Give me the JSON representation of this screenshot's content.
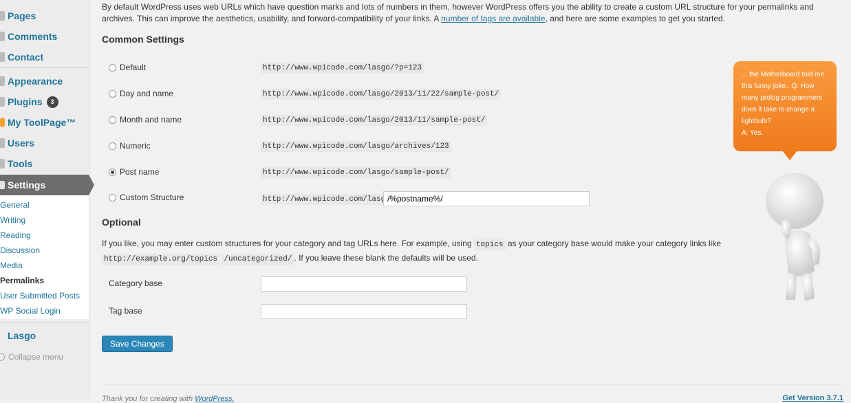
{
  "sidebar": {
    "items": [
      {
        "label": "Pages",
        "icon": "pages-icon"
      },
      {
        "label": "Comments",
        "icon": "comments-icon"
      },
      {
        "label": "Contact",
        "icon": "contact-icon"
      },
      {
        "label": "Appearance",
        "icon": "appearance-icon"
      },
      {
        "label": "Plugins",
        "icon": "plugins-icon",
        "badge": "3"
      },
      {
        "label": "My ToolPage™",
        "icon": "toolpage-icon"
      },
      {
        "label": "Users",
        "icon": "users-icon"
      },
      {
        "label": "Tools",
        "icon": "tools-icon"
      }
    ],
    "settings_label": "Settings",
    "submenu": [
      "General",
      "Writing",
      "Reading",
      "Discussion",
      "Media",
      "Permalinks",
      "User Submitted Posts",
      "WP Social Login"
    ],
    "current_submenu": "Permalinks",
    "lasgo_label": "Lasgo",
    "collapse_label": "Collapse menu"
  },
  "intro": {
    "text_before": "By default WordPress uses web URLs which have question marks and lots of numbers in them, however WordPress offers you the ability to create a custom URL structure for your permalinks and archives. This can improve the aesthetics, usability, and forward-compatibility of your links. A ",
    "link": "number of tags are available",
    "text_after": ", and here are some examples to get you started."
  },
  "common_settings": {
    "heading": "Common Settings",
    "options": [
      {
        "label": "Default",
        "example": "http://www.wpicode.com/lasgo/?p=123",
        "checked": false
      },
      {
        "label": "Day and name",
        "example": "http://www.wpicode.com/lasgo/2013/11/22/sample-post/",
        "checked": false
      },
      {
        "label": "Month and name",
        "example": "http://www.wpicode.com/lasgo/2013/11/sample-post/",
        "checked": false
      },
      {
        "label": "Numeric",
        "example": "http://www.wpicode.com/lasgo/archives/123",
        "checked": false
      },
      {
        "label": "Post name",
        "example": "http://www.wpicode.com/lasgo/sample-post/",
        "checked": true
      }
    ],
    "custom": {
      "label": "Custom Structure",
      "prefix": "http://www.wpicode.com/lasgo",
      "value": "/%postname%/"
    }
  },
  "optional": {
    "heading": "Optional",
    "desc_before": "If you like, you may enter custom structures for your category and tag URLs here. For example, using ",
    "desc_code": "topics",
    "desc_middle": " as your category base would make your category links like ",
    "desc_code2": "http://example.org/topics",
    "desc_code3": "/uncategorized/",
    "desc_after": ". If you leave these blank the defaults will be used.",
    "category_base_label": "Category base",
    "category_base_value": "",
    "tag_base_label": "Tag base",
    "tag_base_value": ""
  },
  "save_label": "Save Changes",
  "footer": {
    "left_text": "Thank you for creating with ",
    "left_link": "WordPress.",
    "right_text": "Get Version 3.7.1"
  },
  "bubble": {
    "lines": [
      "... the Motherboard told me",
      "this funny joke.. Q: How",
      "many prolog programmers",
      "does it take to change a",
      "lightbulb?",
      "A: Yes."
    ]
  },
  "colors": {
    "accent": "#21759b",
    "bubble": "#f58a2c",
    "button": "#2b87b8"
  }
}
